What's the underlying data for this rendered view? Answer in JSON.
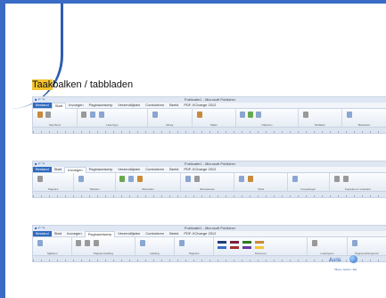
{
  "slide": {
    "title_highlight": "Taak",
    "title_rest": "balken / tabbladen"
  },
  "ribbons": [
    {
      "window_title": "Publicatie1 - Microsoft Publisher",
      "tabs": [
        "Bestand",
        "Start",
        "Invoegen",
        "Paginaontwerp",
        "Verzendlijsten",
        "Controleren",
        "Beeld",
        "PDF-XChange 2012"
      ],
      "active_tab": 1,
      "groups": [
        "Klembord",
        "Lettertype",
        "Alinea",
        "Stijlen",
        "Objecten",
        "Schikken",
        "Bewerken"
      ]
    },
    {
      "window_title": "Publicatie1 - Microsoft Publisher",
      "tabs": [
        "Bestand",
        "Start",
        "Invoegen",
        "Paginaontwerp",
        "Verzendlijsten",
        "Controleren",
        "Beeld",
        "PDF-XChange 2012"
      ],
      "active_tab": 2,
      "groups": [
        "Pagina's",
        "Tabellen",
        "Illustraties",
        "Bouwstenen",
        "Tekst",
        "Koppelingen",
        "Koptekst en voettekst"
      ]
    },
    {
      "window_title": "Publicatie1 - Microsoft Publisher",
      "tabs": [
        "Bestand",
        "Start",
        "Invoegen",
        "Paginaontwerp",
        "Verzendlijsten",
        "Controleren",
        "Beeld",
        "PDF-XChange 2012"
      ],
      "active_tab": 3,
      "groups": [
        "Sjabloon",
        "Pagina-instelling",
        "Indeling",
        "Pagina's",
        "Schema's",
        "Lettertypen",
        "Pagina-achtergrond"
      ]
    }
  ],
  "logo": {
    "name": "Auris",
    "sub": "Tilburg • Gehoor • Taal"
  }
}
